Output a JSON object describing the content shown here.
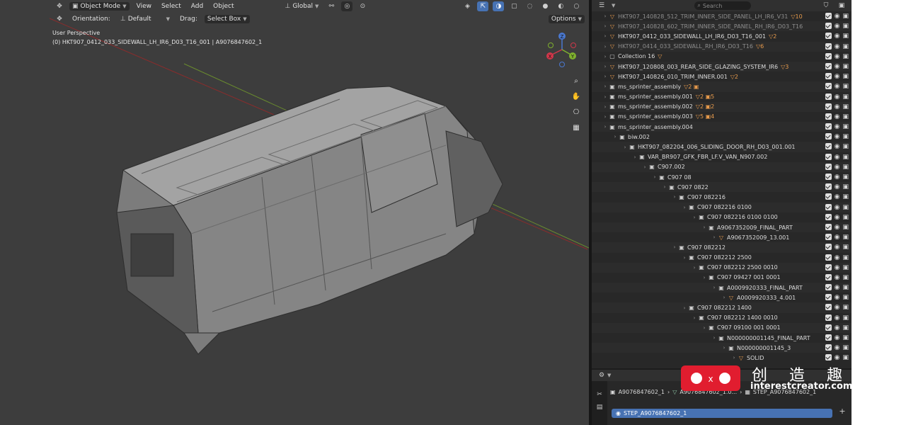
{
  "header": {
    "mode_label": "Object Mode",
    "menu": [
      "View",
      "Select",
      "Add",
      "Object"
    ],
    "transform_orientation": "Global",
    "orientation_label": "Orientation:",
    "orientation_value": "Default",
    "drag_label": "Drag:",
    "drag_value": "Select Box",
    "options_label": "Options"
  },
  "viewport": {
    "perspective": "User Perspective",
    "active_object": "(0) HKT907_0412_033_SIDEWALL_LH_IR6_D03_T16_001 | A9076847602_1",
    "gizmo_axes": [
      "Z",
      "X",
      "Y"
    ]
  },
  "outliner": {
    "search_placeholder": "Search",
    "rows": [
      {
        "label": "HKT907_140828_512_TRIM_INNER_SIDE_PANEL_LH_IR6_V31",
        "extra": "▽10",
        "dim": true
      },
      {
        "label": "HKT907_140828_602_TRIM_INNER_SIDE_PANEL_RH_IR6_D03_T16",
        "extra": "",
        "dim": true
      },
      {
        "label": "HKT907_0412_033_SIDEWALL_LH_IR6_D03_T16_001",
        "extra": "▽2",
        "dim": false
      },
      {
        "label": "HKT907_0414_033_SIDEWALL_RH_IR6_D03_T16",
        "extra": "▽6",
        "dim": true
      },
      {
        "label": "Collection 16",
        "extra": "▽",
        "dim": false
      },
      {
        "label": "HKT907_120808_003_REAR_SIDE_GLAZING_SYSTEM_IR6",
        "extra": "▽3",
        "dim": false
      },
      {
        "label": "HKT907_140826_010_TRIM_INNER.001",
        "extra": "▽2",
        "dim": false
      },
      {
        "label": "ms_sprinter_assembly",
        "extra": "▽2 ▣",
        "dim": false
      },
      {
        "label": "ms_sprinter_assembly.001",
        "extra": "▽2 ▣5",
        "dim": false
      },
      {
        "label": "ms_sprinter_assembly.002",
        "extra": "▽2 ▣2",
        "dim": false
      },
      {
        "label": "ms_sprinter_assembly.003",
        "extra": "▽5 ▣4",
        "dim": false
      },
      {
        "label": "ms_sprinter_assembly.004",
        "extra": "",
        "dim": false
      },
      {
        "label": "biw.002",
        "extra": "",
        "dim": false
      },
      {
        "label": "HKT907_082204_006_SLIDING_DOOR_RH_D03_001.001",
        "extra": "",
        "dim": false
      },
      {
        "label": "VAR_BR907_GFK_FBR_LF.V_VAN_N907.002",
        "extra": "",
        "dim": false
      },
      {
        "label": "C907.002",
        "extra": "",
        "dim": false
      },
      {
        "label": "C907    08",
        "extra": "",
        "dim": false
      },
      {
        "label": "C907    0822",
        "extra": "",
        "dim": false
      },
      {
        "label": "C907    082216",
        "extra": "",
        "dim": false
      },
      {
        "label": "C907    082216 0100",
        "extra": "",
        "dim": false
      },
      {
        "label": "C907    082216 0100 0100",
        "extra": "",
        "dim": false
      },
      {
        "label": "A9067352009_FINAL_PART",
        "extra": "",
        "dim": false
      },
      {
        "label": "A9067352009_13.001",
        "extra": "",
        "dim": false
      },
      {
        "label": "C907    082212",
        "extra": "",
        "dim": false
      },
      {
        "label": "C907    082212 2500",
        "extra": "",
        "dim": false
      },
      {
        "label": "C907    082212 2500 0010",
        "extra": "",
        "dim": false
      },
      {
        "label": "C907    09427 001 0001",
        "extra": "",
        "dim": false
      },
      {
        "label": "A0009920333_FINAL_PART",
        "extra": "",
        "dim": false
      },
      {
        "label": "A0009920333_4.001",
        "extra": "",
        "dim": false
      },
      {
        "label": "C907    082212 1400",
        "extra": "",
        "dim": false
      },
      {
        "label": "C907    082212 1400 0010",
        "extra": "",
        "dim": false
      },
      {
        "label": "C907    09100 001 0001",
        "extra": "",
        "dim": false
      },
      {
        "label": "N000000001145_FINAL_PART",
        "extra": "",
        "dim": false
      },
      {
        "label": "N000000001145_3",
        "extra": "",
        "dim": false
      },
      {
        "label": "SOLID",
        "extra": "",
        "dim": false
      }
    ]
  },
  "properties": {
    "breadcrumb_object": "A9076847602_1",
    "breadcrumb_mesh": "A9076847602_1.0...",
    "breadcrumb_data": "STEP_A9076847602_1",
    "data_field_value": "STEP_A9076847602_1"
  },
  "watermark": {
    "chinese": "创 造 趣 味",
    "domain": "interestcreator.com"
  }
}
